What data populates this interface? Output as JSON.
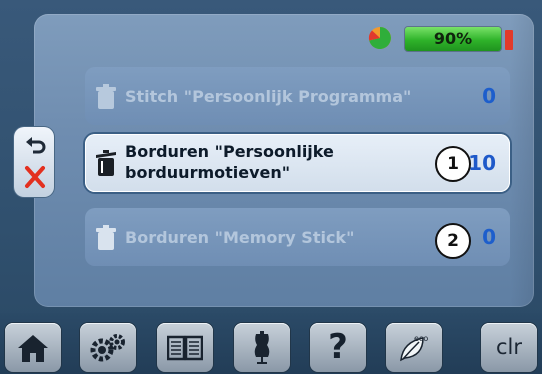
{
  "status": {
    "battery_percent_label": "90%",
    "battery_color": "#2fb32a",
    "battery_end_color": "#e23a2a"
  },
  "left_panel": {
    "back_icon": "undo-arrow-icon",
    "cancel_icon": "red-x-icon"
  },
  "rows": [
    {
      "label": "Stitch \"Persoonlijk Programma\"",
      "count": "0",
      "state": "disabled"
    },
    {
      "label_line1": "Borduren \"Persoonlijke",
      "label_line2": "borduurmotieven\"",
      "count": "10",
      "state": "active"
    },
    {
      "label": "Borduren \"Memory Stick\"",
      "count": "0",
      "state": "disabled"
    }
  ],
  "callouts": [
    "1",
    "2"
  ],
  "toolbar": {
    "items": [
      {
        "name": "home",
        "icon": "home-icon"
      },
      {
        "name": "setup",
        "icon": "gears-icon"
      },
      {
        "name": "tutorial",
        "icon": "book-icon"
      },
      {
        "name": "creative-consultant",
        "icon": "mannequin-icon"
      },
      {
        "name": "help",
        "label": "?",
        "icon": "question-icon"
      },
      {
        "name": "eco",
        "label": "eco",
        "icon": "eco-leaf-icon"
      },
      {
        "name": "clear",
        "label": "clr",
        "icon": "clr-icon"
      }
    ]
  }
}
